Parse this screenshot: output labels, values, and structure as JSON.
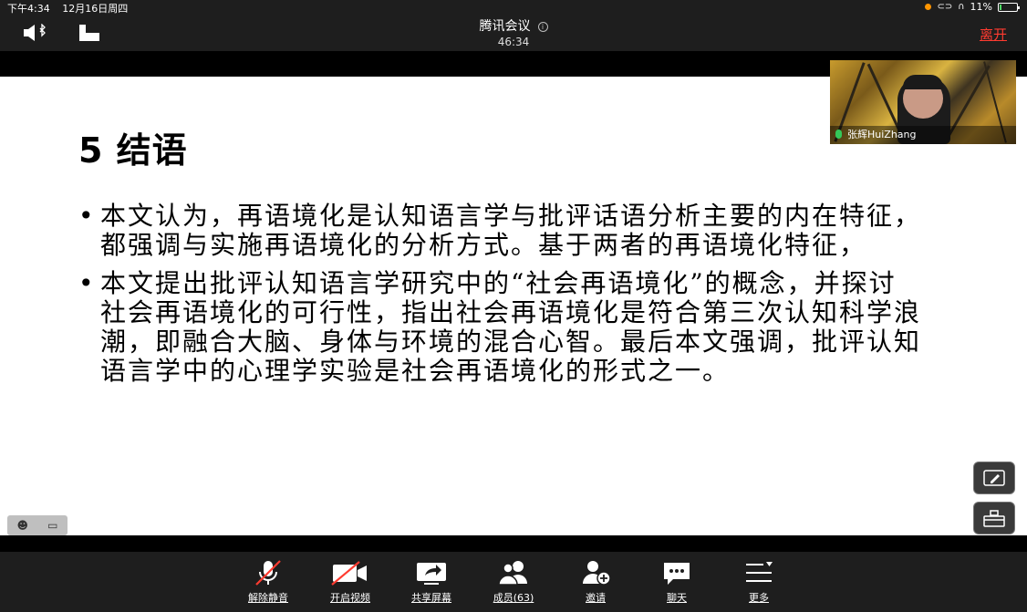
{
  "status_bar": {
    "time": "下午4:34",
    "date": "12月16日周四",
    "battery": "11%",
    "battery_level": 0.11
  },
  "header": {
    "title": "腾讯会议",
    "timer": "46:34",
    "leave_label": "离开"
  },
  "slide": {
    "title": "5 结语",
    "bullets": [
      "本文认为，再语境化是认知语言学与批评话语分析主要的内在特征，都强调与实施再语境化的分析方式。基于两者的再语境化特征，",
      "本文提出批评认知语言学研究中的“社会再语境化”的概念，并探讨社会再语境化的可行性，指出社会再语境化是符合第三次认知科学浪潮，即融合大脑、身体与环境的混合心智。最后本文强调，批评认知语言学中的心理学实验是社会再语境化的形式之一。"
    ]
  },
  "video": {
    "participant_name": "张辉HuiZhang"
  },
  "toolbar": {
    "unmute": "解除静音",
    "start_video": "开启视频",
    "share_screen": "共享屏幕",
    "members": "成员(63)",
    "invite": "邀请",
    "chat": "聊天",
    "more": "更多"
  },
  "colors": {
    "leave": "#ff3b30",
    "mic_active": "#34c759",
    "muted_slash": "#ff3b30"
  }
}
